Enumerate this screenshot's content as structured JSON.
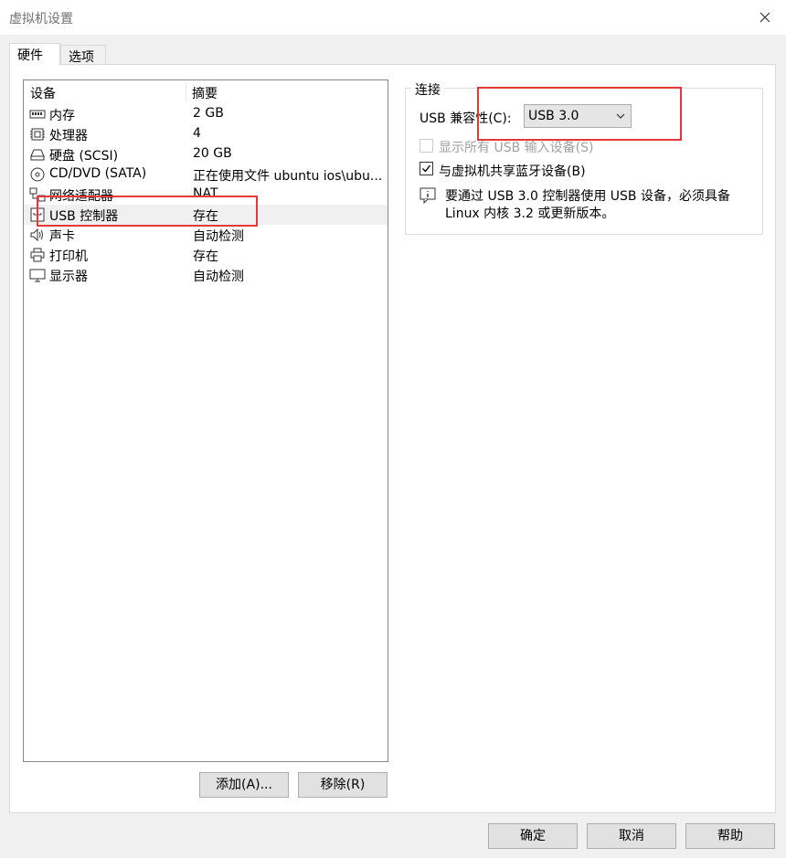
{
  "window": {
    "title": "虚拟机设置"
  },
  "tabs": [
    {
      "label": "硬件",
      "active": true
    },
    {
      "label": "选项",
      "active": false
    }
  ],
  "device_list": {
    "columns": [
      "设备",
      "摘要"
    ],
    "rows": [
      {
        "icon": "memory-icon",
        "name": "内存",
        "summary": "2 GB"
      },
      {
        "icon": "processor-icon",
        "name": "处理器",
        "summary": "4"
      },
      {
        "icon": "hard-disk-icon",
        "name": "硬盘 (SCSI)",
        "summary": "20 GB"
      },
      {
        "icon": "cd-dvd-icon",
        "name": "CD/DVD (SATA)",
        "summary": "正在使用文件 ubuntu ios\\ubu..."
      },
      {
        "icon": "network-adapter-icon",
        "name": "网络适配器",
        "summary": "NAT"
      },
      {
        "icon": "usb-icon",
        "name": "USB 控制器",
        "summary": "存在",
        "selected": true
      },
      {
        "icon": "sound-icon",
        "name": "声卡",
        "summary": "自动检测"
      },
      {
        "icon": "printer-icon",
        "name": "打印机",
        "summary": "存在"
      },
      {
        "icon": "display-icon",
        "name": "显示器",
        "summary": "自动检测"
      }
    ]
  },
  "list_buttons": {
    "add": "添加(A)...",
    "remove": "移除(R)"
  },
  "connection": {
    "legend": "连接",
    "usb_compat_label": "USB 兼容性(C):",
    "usb_compat_value": "USB 3.0",
    "show_all_usb_label": "显示所有 USB 输入设备(S)",
    "show_all_usb_checked": false,
    "share_bluetooth_label": "与虚拟机共享蓝牙设备(B)",
    "share_bluetooth_checked": true,
    "info_line1": "要通过 USB 3.0 控制器使用 USB 设备，必须具备",
    "info_line2": "Linux 内核 3.2 或更新版本。"
  },
  "footer_buttons": {
    "ok": "确定",
    "cancel": "取消",
    "help": "帮助"
  },
  "colors": {
    "highlight_box": "#e53935",
    "selected_row": "#f0f0f0",
    "disabled_text": "#a0a0a0"
  }
}
